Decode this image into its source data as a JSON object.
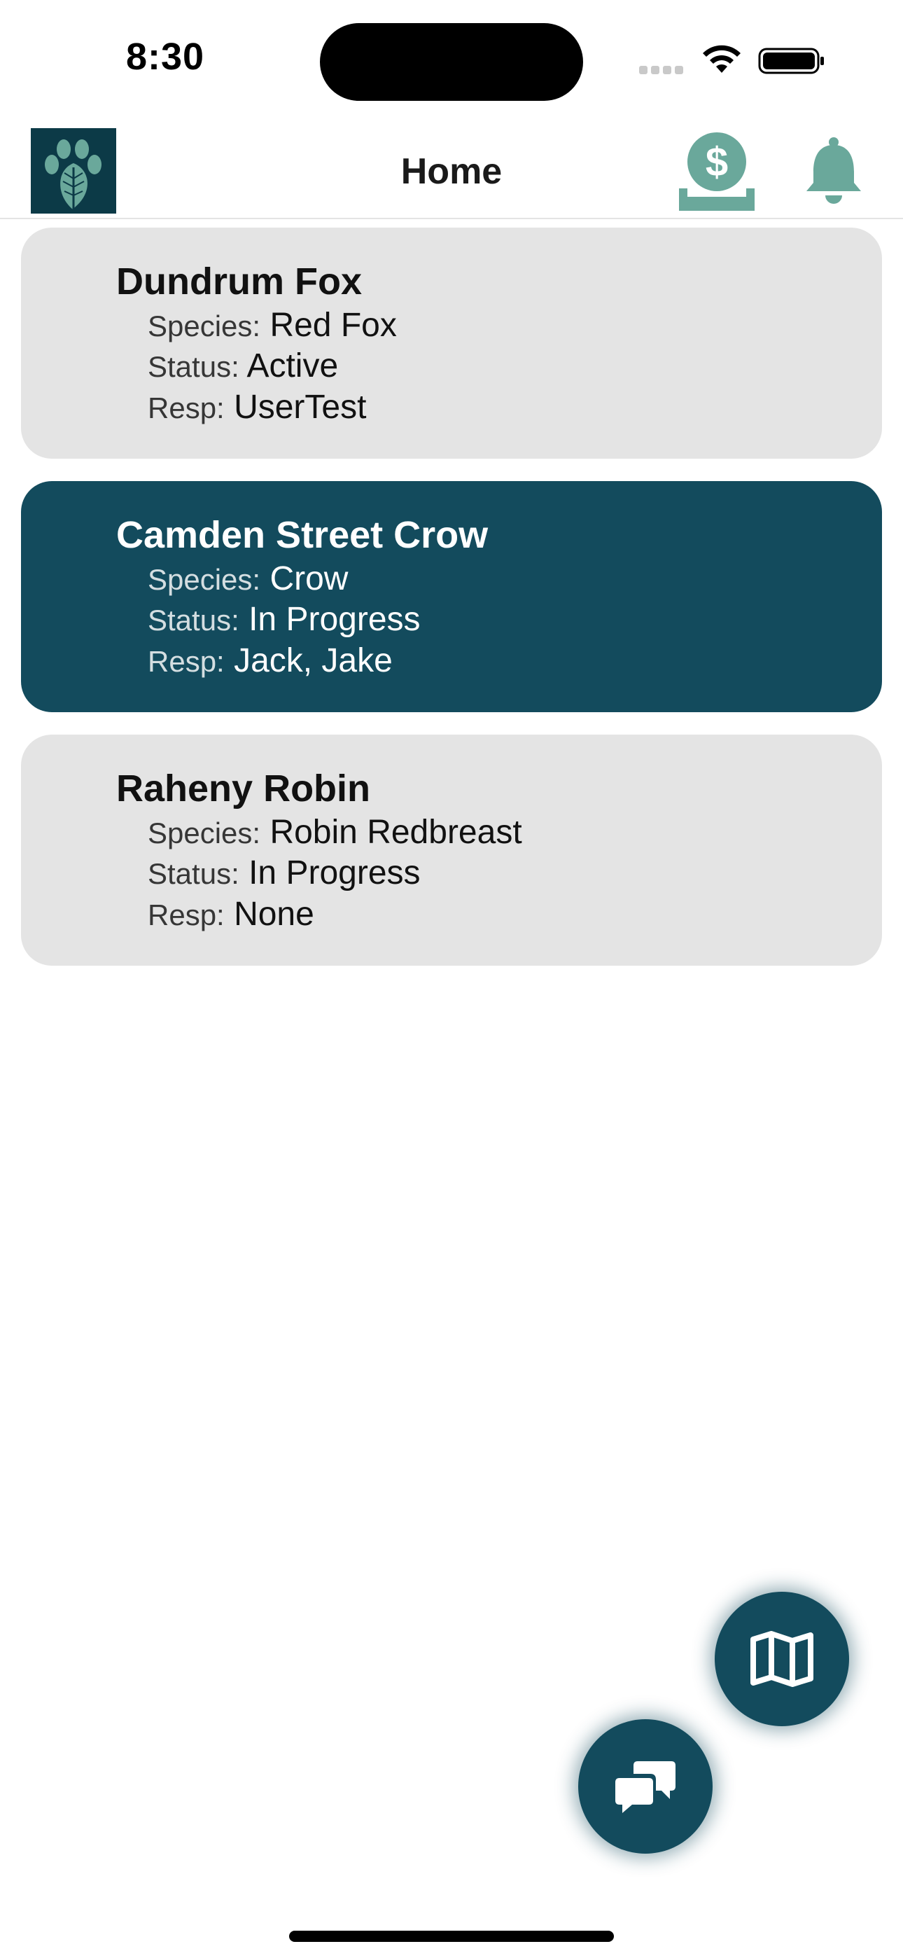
{
  "status_bar": {
    "time": "8:30"
  },
  "header": {
    "title": "Home",
    "logo_icon": "paw-feather-logo",
    "donate_icon": "dollar-coin-hand-icon",
    "notifications_icon": "bell-icon"
  },
  "cards": [
    {
      "name": "Dundrum Fox",
      "species_label": "Species:",
      "species": "Red Fox",
      "status_label": "Status:",
      "status": "Active",
      "resp_label": "Resp:",
      "resp": "UserTest",
      "selected": false
    },
    {
      "name": "Camden Street Crow",
      "species_label": "Species:",
      "species": "Crow",
      "status_label": "Status:",
      "status": "In Progress",
      "resp_label": "Resp:",
      "resp": "Jack, Jake",
      "selected": true
    },
    {
      "name": "Raheny Robin",
      "species_label": "Species:",
      "species": "Robin Redbreast",
      "status_label": "Status:",
      "status": "In Progress",
      "resp_label": "Resp:",
      "resp": "None",
      "selected": false
    }
  ],
  "fabs": {
    "map_icon": "map-icon",
    "chat_icon": "chat-bubbles-icon"
  },
  "colors": {
    "primary": "#134b5d",
    "accent": "#6aa89b",
    "card_background": "#e4e4e4",
    "logo_background": "#0c3a47"
  }
}
